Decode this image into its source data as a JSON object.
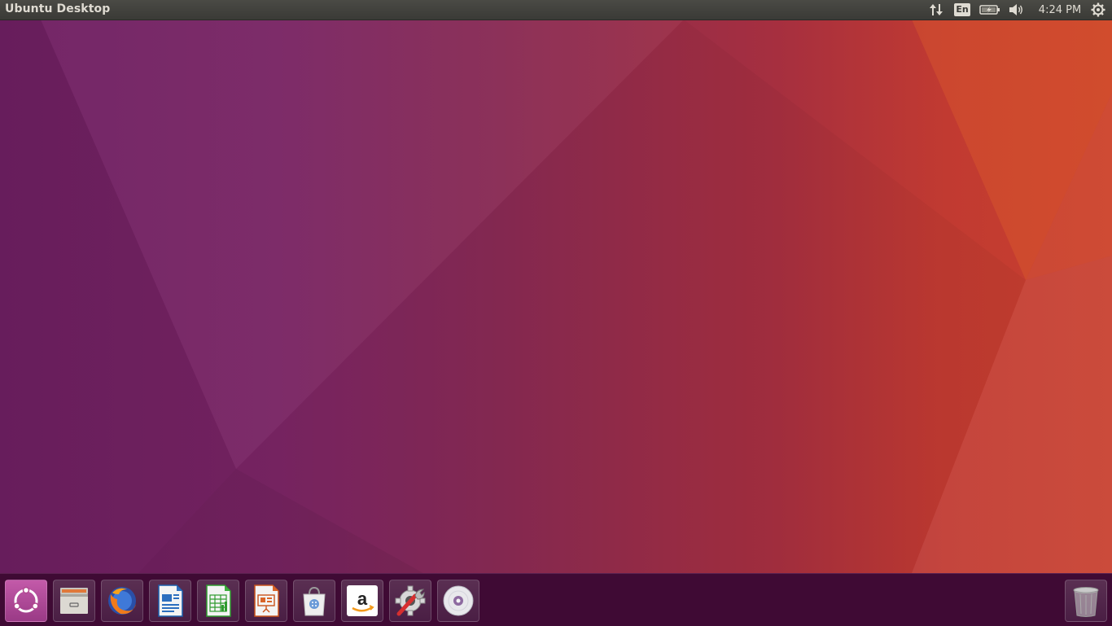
{
  "top_panel": {
    "title": "Ubuntu Desktop",
    "keyboard_layout": "En",
    "clock": "4:24 PM",
    "icons": {
      "network": "network-transfer-icon",
      "battery": "battery-icon",
      "sound": "volume-icon",
      "session": "gear-icon"
    }
  },
  "launcher": {
    "items": [
      {
        "name": "dash-home",
        "icon": "ubuntu-logo-icon"
      },
      {
        "name": "files",
        "icon": "file-cabinet-icon"
      },
      {
        "name": "firefox",
        "icon": "firefox-icon"
      },
      {
        "name": "libreoffice-writer",
        "icon": "document-icon"
      },
      {
        "name": "libreoffice-calc",
        "icon": "spreadsheet-icon"
      },
      {
        "name": "libreoffice-impress",
        "icon": "presentation-icon"
      },
      {
        "name": "ubuntu-software",
        "icon": "shopping-bag-icon"
      },
      {
        "name": "amazon",
        "icon": "amazon-icon"
      },
      {
        "name": "system-settings",
        "icon": "settings-wrench-icon"
      },
      {
        "name": "optical-disc",
        "icon": "disc-icon"
      }
    ],
    "trash": {
      "name": "trash",
      "icon": "trash-icon"
    }
  },
  "colors": {
    "panel_bg": "#3c3b37",
    "launcher_bg": "#3f0a34",
    "wallpaper_left": "#6e1f62",
    "wallpaper_right": "#c8402f"
  }
}
